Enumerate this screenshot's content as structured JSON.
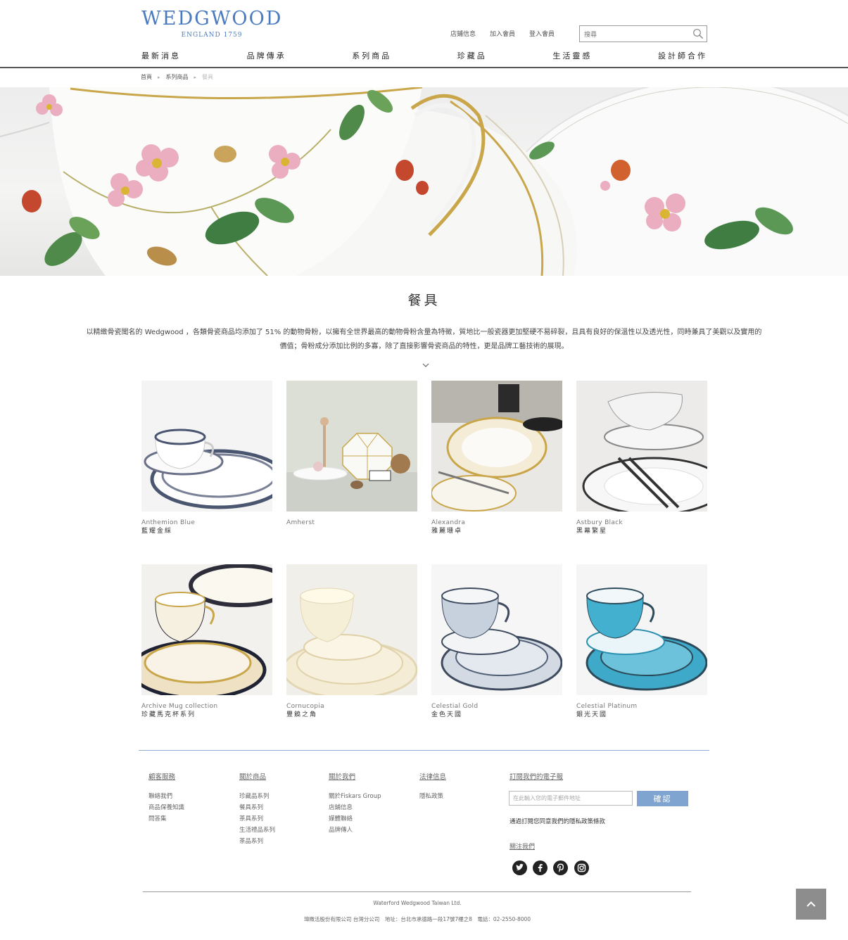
{
  "header": {
    "logo_main": "WEDGWOOD",
    "logo_sub": "ENGLAND 1759",
    "top_links": [
      "店鋪信息",
      "加入會員",
      "登入會員"
    ],
    "search_placeholder": "搜尋",
    "nav": [
      "最新消息",
      "品牌傳承",
      "系列商品",
      "珍藏品",
      "生活靈感",
      "設計師合作"
    ]
  },
  "breadcrumb": [
    "首頁",
    "系列商品",
    "餐具"
  ],
  "page": {
    "title": "餐具",
    "intro": "以精緻骨瓷聞名的 Wedgwood ，各類骨瓷商品均添加了 51% 的動物骨粉，以擁有全世界最高的動物骨粉含量為特徵，質地比一般瓷器更加堅硬不易碎裂，且具有良好的保溫性以及透光性，同時兼具了美觀以及實用的價值；骨粉成分添加比例的多寡，除了直接影響骨瓷商品的特性，更是品牌工藝技術的展現。"
  },
  "products": [
    {
      "en": "Anthemion Blue",
      "zh": "藍耀金綵"
    },
    {
      "en": "Amherst",
      "zh": ""
    },
    {
      "en": "Alexandra",
      "zh": "雅麗珊卓"
    },
    {
      "en": "Astbury Black",
      "zh": "黑幕繁星"
    },
    {
      "en": "Archive Mug collection",
      "zh": "珍藏馬克杯系列"
    },
    {
      "en": "Cornucopia",
      "zh": "豐饒之角"
    },
    {
      "en": "Celestial Gold",
      "zh": "金色天國"
    },
    {
      "en": "Celestial Platinum",
      "zh": "銀光天國"
    }
  ],
  "footer": {
    "columns": [
      {
        "title": "顧客服務",
        "items": [
          "聯絡我們",
          "商品保養知識",
          "問答集"
        ]
      },
      {
        "title": "關於商品",
        "items": [
          "珍藏品系列",
          "餐具系列",
          "茶具系列",
          "生活禮品系列",
          "茶品系列"
        ]
      },
      {
        "title": "關於我們",
        "items": [
          "關於Fiskars Group",
          "店鋪信息",
          "媒體聯絡",
          "品牌傳人"
        ]
      },
      {
        "title": "法律信息",
        "items": [
          "隱私政策"
        ]
      }
    ],
    "newsletter": {
      "title": "訂閱我們的電子報",
      "placeholder": "在此輸入您的電子郵件地址",
      "button": "確認",
      "note": "通過訂閱您同意我們的隱私政策條款"
    },
    "follow_title": "關注我們",
    "social": [
      "twitter-icon",
      "facebook-icon",
      "pinterest-icon",
      "instagram-icon"
    ],
    "company_en": "Waterford Wedgwood Taiwan Ltd.",
    "company_info": "瑋緻活股份有限公司 台灣分公司　地址：台北市承德路一段17號7樓之8　電話：02-2550-8000"
  },
  "colors": {
    "brand": "#4a7bc0",
    "button": "#7ea4cf",
    "back_to_top": "#8d8d8d"
  }
}
